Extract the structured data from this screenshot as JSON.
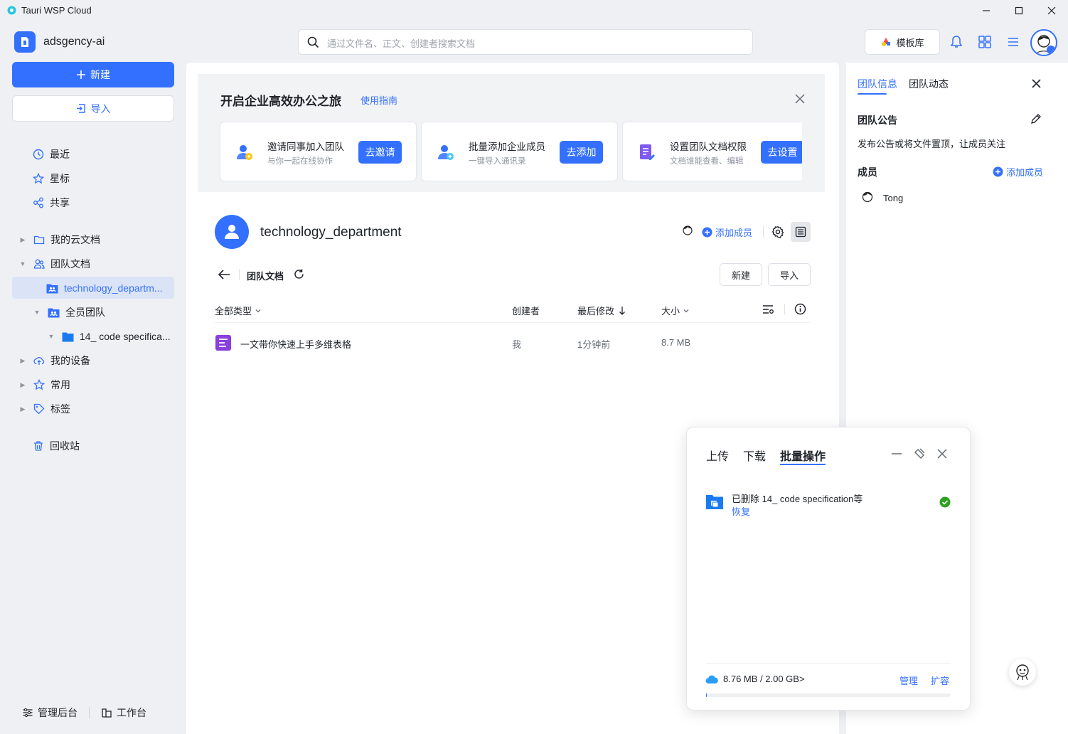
{
  "window": {
    "title": "Tauri WSP Cloud"
  },
  "header": {
    "team_name": "adsgency-ai",
    "search_placeholder": "通过文件名、正文、创建者搜索文档",
    "template_label": "模板库"
  },
  "sidebar": {
    "new_label": "新建",
    "import_label": "导入",
    "quick": [
      {
        "label": "最近",
        "icon": "clock-icon"
      },
      {
        "label": "星标",
        "icon": "star-icon"
      },
      {
        "label": "共享",
        "icon": "share-icon"
      }
    ],
    "tree": {
      "my_cloud": "我的云文档",
      "team_docs": "团队文档",
      "tech_dept": "technology_departm...",
      "all_team": "全员团队",
      "code_spec": "14_ code specifica...",
      "my_devices": "我的设备",
      "common": "常用",
      "tags": "标签",
      "trash": "回收站"
    },
    "footer": {
      "admin": "管理后台",
      "workspace": "工作台"
    }
  },
  "banner": {
    "title": "开启企业高效办公之旅",
    "guide_link": "使用指南",
    "cards": [
      {
        "title": "邀请同事加入团队",
        "subtitle": "与你一起在线协作",
        "button": "去邀请"
      },
      {
        "title": "批量添加企业成员",
        "subtitle": "一键导入通讯录",
        "button": "去添加"
      },
      {
        "title": "设置团队文档权限",
        "subtitle": "文档谁能查看、编辑",
        "button": "去设置"
      }
    ]
  },
  "department": {
    "name": "technology_department",
    "add_member": "添加成员",
    "breadcrumb": "团队文档",
    "new_btn": "新建",
    "import_btn": "导入"
  },
  "table": {
    "headers": {
      "type": "全部类型",
      "creator": "创建者",
      "modified": "最后修改",
      "size": "大小"
    },
    "rows": [
      {
        "name": "一文带你快速上手多维表格",
        "creator": "我",
        "modified": "1分钟前",
        "size": "8.7 MB"
      }
    ]
  },
  "right_panel": {
    "tabs": [
      "团队信息",
      "团队动态"
    ],
    "active_tab": 0,
    "announcement_title": "团队公告",
    "announcement_text": "发布公告或将文件置顶，让成员关注",
    "members_title": "成员",
    "add_member": "添加成员",
    "members": [
      "Tong"
    ]
  },
  "transfer_popup": {
    "tabs": [
      "上传",
      "下载",
      "批量操作"
    ],
    "active_tab": 2,
    "item_text": "已删除 14_ code specification等",
    "item_action": "恢复",
    "storage": "8.76 MB / 2.00 GB>",
    "manage": "管理",
    "expand": "扩容"
  },
  "colors": {
    "accent": "#3370ff",
    "success": "#2ea121"
  }
}
